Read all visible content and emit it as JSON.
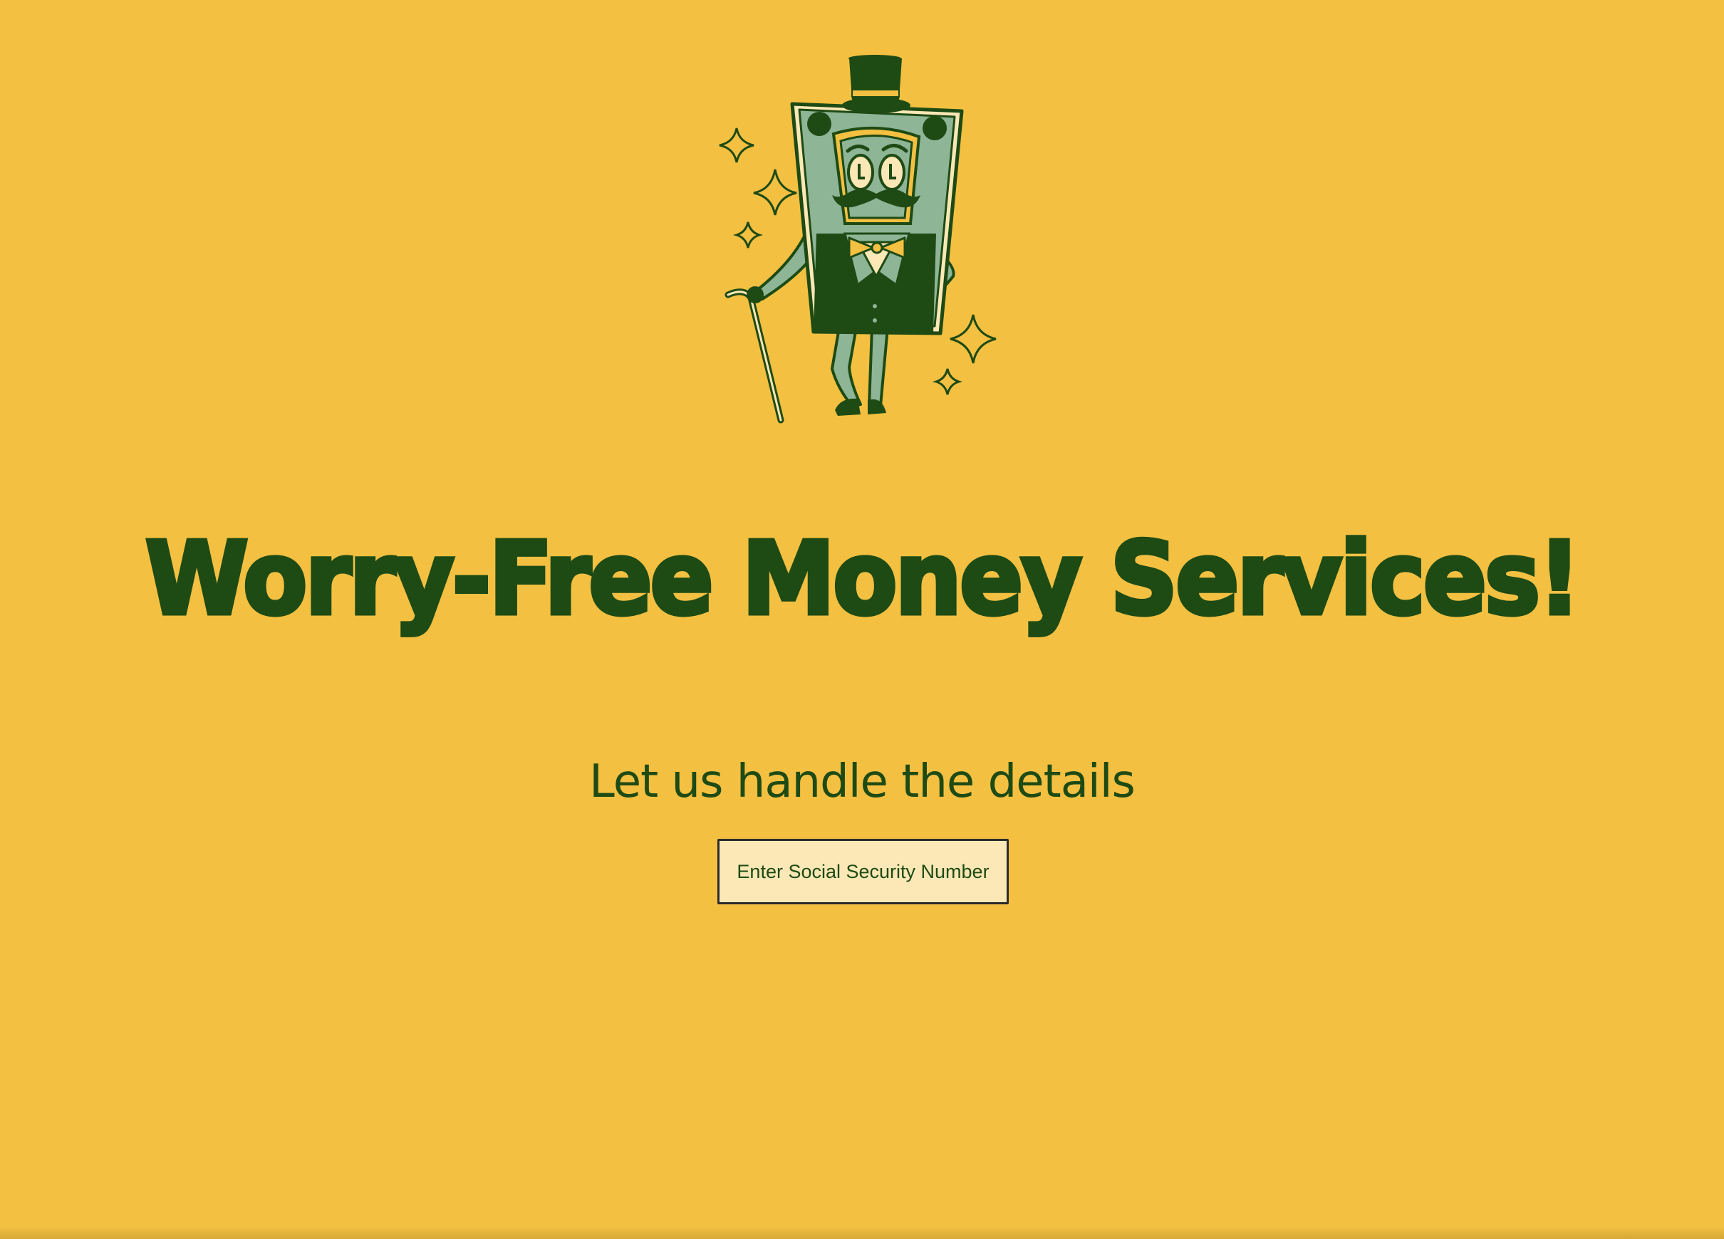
{
  "hero": {
    "illustration": "top-hat-money-mascot-illustration",
    "headline": "Worry-Free Money Services!",
    "subheadline": "Let us handle the details"
  },
  "form": {
    "ssn_input": {
      "placeholder": "Enter Social Security Number",
      "value": ""
    }
  },
  "colors": {
    "background": "#F3C042",
    "text": "#1E4A14",
    "input_background": "#FCE8B6",
    "mascot_body": "#8DB596",
    "mascot_dark": "#1E4A14",
    "mascot_light": "#FCE8B6"
  }
}
